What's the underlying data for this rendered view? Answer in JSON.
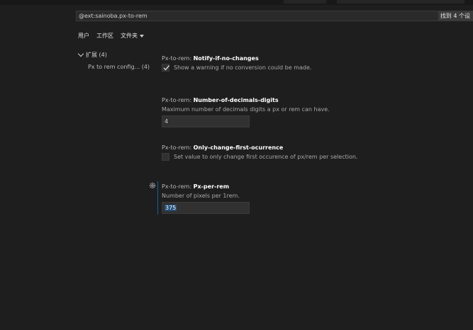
{
  "search": {
    "query": "@ext:sainoba.px-to-rem",
    "result_count": "找到 4 个设"
  },
  "tabs": [
    {
      "label": "用户"
    },
    {
      "label": "工作区"
    },
    {
      "label": "文件夹"
    }
  ],
  "tree": {
    "group_label": "扩展 (4)",
    "child_label": "Px to rem config... (4)"
  },
  "settings": [
    {
      "category": "Px-to-rem: ",
      "name": "Notify-if-no-changes",
      "description": "Show a warning if no conversion could be made.",
      "type": "checkbox",
      "checked": true
    },
    {
      "category": "Px-to-rem: ",
      "name": "Number-of-decimals-digits",
      "description": "Maximum number of decimals digits a px or rem can have.",
      "type": "number",
      "value": "4"
    },
    {
      "category": "Px-to-rem: ",
      "name": "Only-change-first-ocurrence",
      "description": "Set value to only change first occurence of px/rem per selection.",
      "type": "checkbox",
      "checked": false
    },
    {
      "category": "Px-to-rem: ",
      "name": "Px-per-rem",
      "description": "Number of pixels per 1rem.",
      "type": "number",
      "value": "375"
    }
  ],
  "icons": {
    "gear": "gear-icon",
    "check": "checkmark-icon",
    "chevron": "chevron-down-icon"
  },
  "colors": {
    "background": "#1e1e1e",
    "focus_accent": "#0e639c",
    "selection": "#264f78"
  }
}
